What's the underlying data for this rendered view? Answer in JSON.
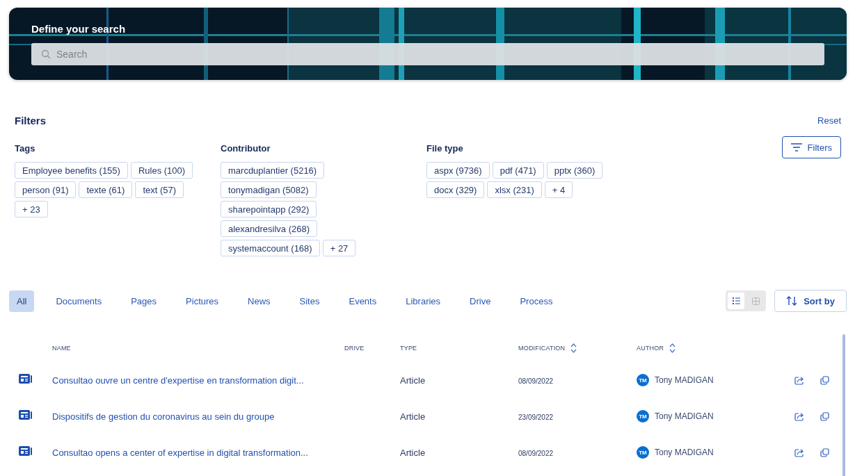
{
  "hero": {
    "title": "Define your search",
    "search": {
      "placeholder": "Search"
    }
  },
  "filters": {
    "title": "Filters",
    "reset": "Reset",
    "button": "Filters",
    "groups": [
      {
        "title": "Tags",
        "chips": [
          "Employee benefits (155)",
          "Rules (100)",
          "person (91)",
          "texte (61)",
          "text (57)",
          "+ 23"
        ]
      },
      {
        "title": "Contributor",
        "chips": [
          "marcduplantier (5216)",
          "tonymadigan (5082)",
          "sharepointapp (292)",
          "alexandresilva (268)",
          "systemaccount (168)",
          "+ 27"
        ]
      },
      {
        "title": "File type",
        "chips": [
          "aspx (9736)",
          "pdf (471)",
          "pptx (360)",
          "docx (329)",
          "xlsx (231)",
          "+ 4"
        ]
      }
    ]
  },
  "tabs": [
    {
      "label": "All",
      "selected": true
    },
    {
      "label": "Documents",
      "selected": false
    },
    {
      "label": "Pages",
      "selected": false
    },
    {
      "label": "Pictures",
      "selected": false
    },
    {
      "label": "News",
      "selected": false
    },
    {
      "label": "Sites",
      "selected": false
    },
    {
      "label": "Events",
      "selected": false
    },
    {
      "label": "Libraries",
      "selected": false
    },
    {
      "label": "Drive",
      "selected": false
    },
    {
      "label": "Process",
      "selected": false
    }
  ],
  "views": [
    {
      "kind": "list",
      "selected": true
    },
    {
      "kind": "grid",
      "selected": false
    }
  ],
  "sort_button": "Sort by",
  "table": {
    "columns": [
      {
        "label": "NAME",
        "sortable": false
      },
      {
        "label": "DRIVE",
        "sortable": false
      },
      {
        "label": "TYPE",
        "sortable": false
      },
      {
        "label": "MODIFICATION",
        "sortable": true
      },
      {
        "label": "AUTHOR",
        "sortable": true
      }
    ],
    "rows": [
      {
        "name": "Consultao ouvre un centre d'expertise en transformation digit...",
        "type": "Article",
        "modified": "08/09/2022",
        "author": {
          "initials": "TM",
          "name": "Tony MADIGAN"
        }
      },
      {
        "name": "Dispositifs de gestion du coronavirus au sein du groupe",
        "type": "Article",
        "modified": "23/09/2022",
        "author": {
          "initials": "TM",
          "name": "Tony MADIGAN"
        }
      },
      {
        "name": "Consultao opens a center of expertise in digital transformation...",
        "type": "Article",
        "modified": "08/09/2022",
        "author": {
          "initials": "TM",
          "name": "Tony MADIGAN"
        }
      }
    ]
  }
}
